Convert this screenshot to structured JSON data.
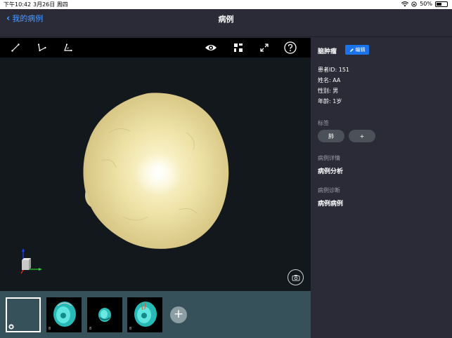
{
  "status": {
    "time": "下午10:42",
    "date": "3月26日 周四",
    "battery": "50%",
    "battery_level": 0.5
  },
  "nav": {
    "back_label": "我的病例",
    "title": "病例"
  },
  "toolbar": {
    "left_tools": [
      "measure-line-icon",
      "angle-icon",
      "angle-alt-icon"
    ],
    "right_tools": [
      "eye-icon",
      "grid-icon",
      "fullscreen-icon",
      "help-icon"
    ]
  },
  "thumbnails": [
    {
      "label": "",
      "selected": true
    },
    {
      "label": "8",
      "selected": false
    },
    {
      "label": "8",
      "selected": false
    },
    {
      "label": "8",
      "selected": false
    }
  ],
  "panel": {
    "title": "脑肿瘤",
    "edit_label": "编辑",
    "patient_id": "患者ID: 151",
    "name": "姓名: AA",
    "gender": "性别: 男",
    "age": "年龄: 1岁",
    "tags_label": "标签",
    "tags": [
      "肺"
    ],
    "add_tag": "+",
    "details_label": "病例详情",
    "details_value": "病例分析",
    "diagnosis_label": "病例诊断",
    "diagnosis_value": "病例病例"
  },
  "colors": {
    "accent": "#1a73e8",
    "back_link": "#4b9cff",
    "tumor": "#efe3a8"
  }
}
